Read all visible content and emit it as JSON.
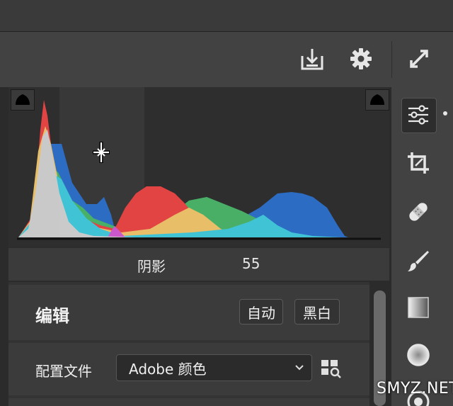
{
  "colors": {
    "red": "#e84545",
    "green": "#4ab469",
    "blue": "#2d6ec8",
    "cyan": "#42c8dc",
    "yellow": "#f0c36a",
    "magenta": "#d05ad0",
    "gray": "#cfcfcf"
  },
  "toolbar": {
    "icons": [
      "save-icon",
      "gear-icon",
      "fullscreen-icon"
    ]
  },
  "histogram": {
    "readout_label": "阴影",
    "readout_value": "55"
  },
  "edit": {
    "title": "编辑",
    "auto_label": "自动",
    "bw_label": "黑白"
  },
  "profile": {
    "label": "配置文件",
    "value": "Adobe 颜色"
  },
  "rail": {
    "icons": [
      "sliders-icon",
      "crop-icon",
      "bandage-icon",
      "brush-icon",
      "gradient-icon",
      "radial-icon",
      "redeye-icon"
    ]
  },
  "watermark": "SMYZ.NET"
}
